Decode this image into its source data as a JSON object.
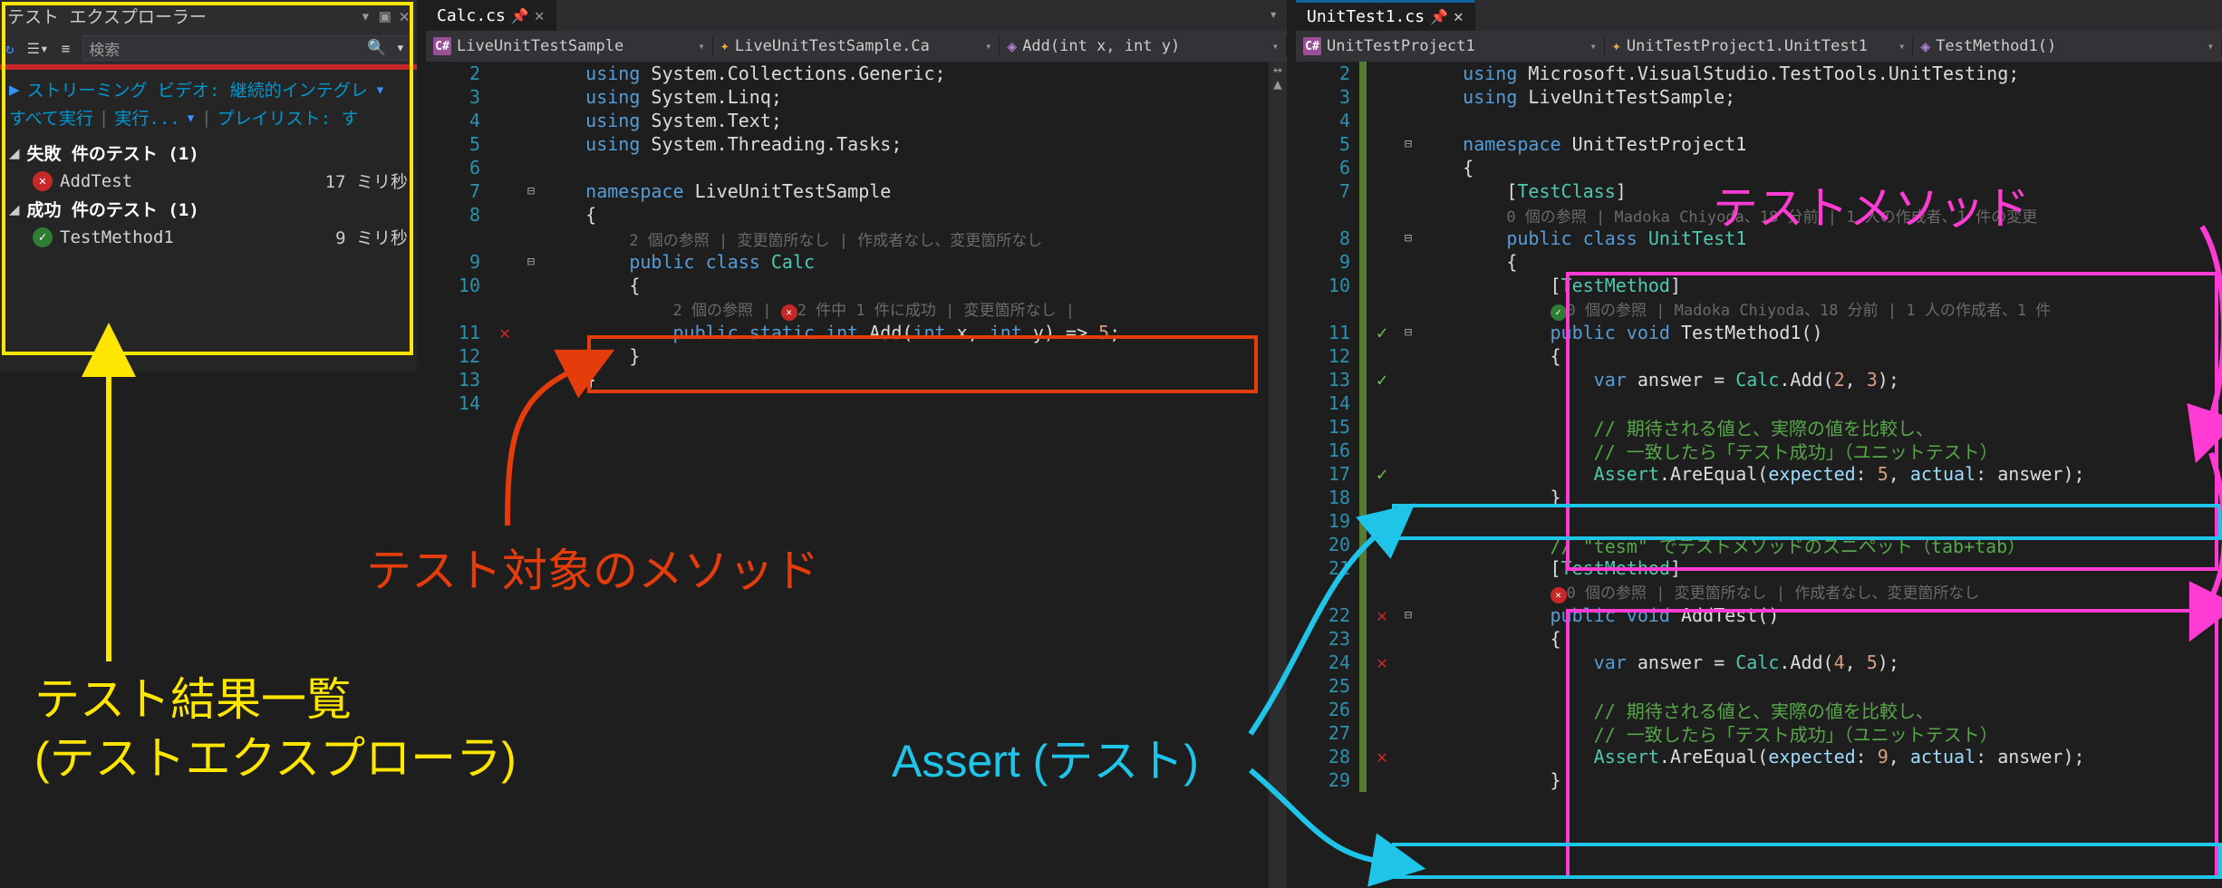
{
  "test_explorer": {
    "title": "テスト エクスプローラー",
    "search_placeholder": "検索",
    "streaming_label": "ストリーミング ビデオ: 継続的インテグレ",
    "run_all": "すべて実行",
    "run": "実行...",
    "playlist": "プレイリスト: す",
    "failed_group": "失敗 件のテスト  (1)",
    "passed_group": "成功 件のテスト  (1)",
    "fail_item": "AddTest",
    "fail_time": "17 ミリ秒",
    "pass_item": "TestMethod1",
    "pass_time": "9 ミリ秒"
  },
  "calc_tab": "Calc.cs",
  "unit_tab": "UnitTest1.cs",
  "calc_nav": {
    "proj": "LiveUnitTestSample",
    "cls": "LiveUnitTestSample.Ca",
    "mtd": "Add(int x, int y)"
  },
  "unit_nav": {
    "proj": "UnitTestProject1",
    "cls": "UnitTestProject1.UnitTest1",
    "mtd": "TestMethod1()"
  },
  "calc_lines": {
    "l2": [
      "using ",
      "System",
      ".",
      "Collections",
      ".",
      "Generic",
      ";"
    ],
    "l3": [
      "using ",
      "System",
      ".",
      "Linq",
      ";"
    ],
    "l4": [
      "using ",
      "System",
      ".",
      "Text",
      ";"
    ],
    "l5": [
      "using ",
      "System",
      ".",
      "Threading",
      ".",
      "Tasks",
      ";"
    ],
    "ns": [
      "namespace ",
      "LiveUnitTestSample"
    ],
    "lens_cls": "2 個の参照 | 変更箇所なし | 作成者なし、変更箇所なし",
    "cls": [
      "public class ",
      "Calc"
    ],
    "lens_mtd": [
      "2 個の参照 | ",
      "2 件中 1 件に成功",
      " | 変更箇所なし |"
    ],
    "mtd": [
      "public static ",
      "int",
      " Add",
      "(",
      "int",
      " x",
      ", ",
      "int",
      " y",
      ")",
      " => ",
      "5",
      ";"
    ]
  },
  "unit_lines": {
    "u1": [
      "using ",
      "Microsoft",
      ".",
      "VisualStudio",
      ".",
      "TestTools",
      ".",
      "UnitTesting",
      ";"
    ],
    "u2": [
      "using ",
      "LiveUnitTestSample",
      ";"
    ],
    "ns": [
      "namespace ",
      "UnitTestProject1"
    ],
    "attr_cls": "[TestClass]",
    "lens_cls": "0 個の参照 | Madoka Chiyoda、18 分前 | 1 人の作成者、1 件の変更",
    "cls": [
      "public class ",
      "UnitTest1"
    ],
    "attr_m1": "[TestMethod]",
    "lens_m1": "0 個の参照 | Madoka Chiyoda、18 分前 | 1 人の作成者、1 件",
    "m1": [
      "public ",
      "void",
      " TestMethod1",
      "()"
    ],
    "m1_body1": [
      "var",
      " answer = ",
      "Calc",
      ".",
      "Add",
      "(",
      "2",
      ", ",
      "3",
      ")",
      ";"
    ],
    "m1_c1": "// 期待される値と、実際の値を比較し、",
    "m1_c2": "// 一致したら「テスト成功」（ユニットテスト）",
    "m1_assert": [
      "Assert",
      ".",
      "AreEqual",
      "(",
      "expected",
      ": ",
      "5",
      ", ",
      "actual",
      ": answer",
      ")",
      ";"
    ],
    "snip": "// \"tesm\" でテストメソッドのスニペット（tab+tab）",
    "attr_m2": "[TestMethod]",
    "lens_m2": "0 個の参照 | 変更箇所なし | 作成者なし、変更箇所なし",
    "m2": [
      "public ",
      "void",
      " AddTest",
      "()"
    ],
    "m2_body1": [
      "var",
      " answer = ",
      "Calc",
      ".",
      "Add",
      "(",
      "4",
      ", ",
      "5",
      ")",
      ";"
    ],
    "m2_c1": "// 期待される値と、実際の値を比較し、",
    "m2_c2": "// 一致したら「テスト成功」（ユニットテスト）",
    "m2_assert": [
      "Assert",
      ".",
      "AreEqual",
      "(",
      "expected",
      ": ",
      "9",
      ", ",
      "actual",
      ": answer",
      ")",
      ";"
    ]
  },
  "annotations": {
    "yellow": "テスト結果一覧\n(テストエクスプローラ)",
    "red": "テスト対象のメソッド",
    "cyan": "Assert (テスト)",
    "magenta": "テストメソッド"
  }
}
